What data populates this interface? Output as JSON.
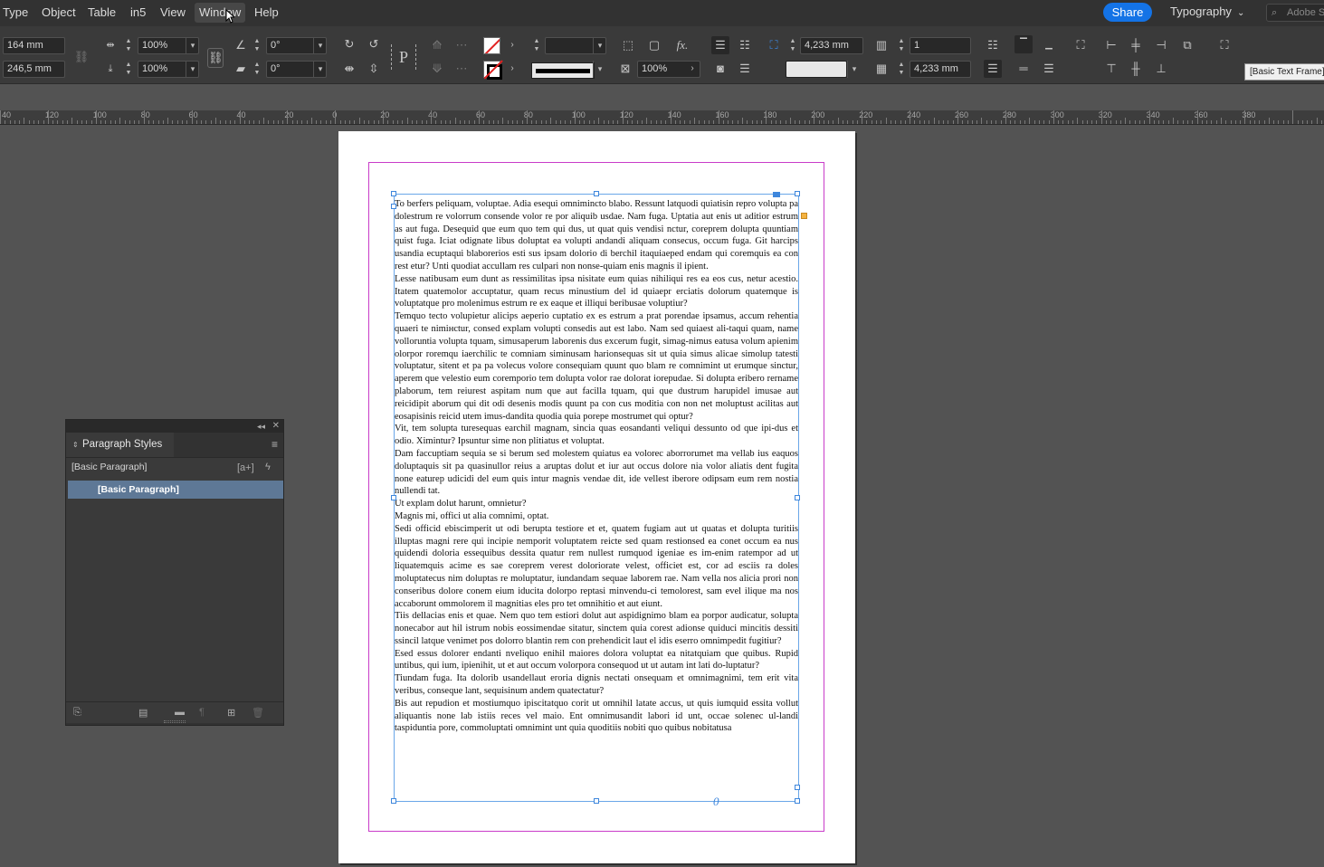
{
  "menubar": {
    "items": [
      "Type",
      "Object",
      "Table",
      "in5",
      "View",
      "Window",
      "Help"
    ],
    "active": "Window",
    "share_label": "Share",
    "workspace_label": "Typography",
    "search_placeholder": "Adobe S"
  },
  "control": {
    "width": "164 mm",
    "height": "246,5 mm",
    "scale_x": "100%",
    "scale_y": "100%",
    "rotation": "0°",
    "shear": "0°",
    "opacity": "100%",
    "inset_top": "4,233 mm",
    "inset_bottom": "4,233 mm",
    "columns": "1",
    "frame_style": "[Basic Text Frame]"
  },
  "ruler": {
    "labels": [
      "40",
      "120",
      "100",
      "80",
      "60",
      "40",
      "20",
      "0",
      "20",
      "40",
      "60",
      "80",
      "100",
      "120",
      "140",
      "160",
      "180",
      "200",
      "220",
      "240",
      "260",
      "280",
      "300",
      "320",
      "340",
      "360",
      "380"
    ]
  },
  "document": {
    "paragraphs": [
      "To berfers peliquam, voluptae. Adia esequi omnimincto blabo. Ressunt latquodi quiatisin repro volupta pa dolestrum re volorrum consende volor re por aliquib usdae. Nam fuga. Uptatia aut enis ut aditior estrum as aut fuga. Desequid que eum quo tem qui dus, ut quat quis vendisi nctur, coreprem dolupta quuntiam quist fuga. Iciat odignate libus doluptat ea volupti andandi aliquam consecus, occum fuga. Git harcips usandia ecuptaqui blaborerios esti sus ipsam dolorio di berchil itaquiaeped endam qui coremquis ea con rest etur? Unti quodiat accullam res culpari non nonse-quiam enis magnis il ipient.",
      "Lesse natibusam eum dunt as ressimilitas ipsa nisitate eum quias nihiliqui res ea eos cus, netur acestio. Itatem quatemolor accuptatur, quam recus minustium del id quiaepr erciatis dolorum quatemque is voluptatque pro molenimus estrum re ex eaque et illiqui beribusae voluptiur?",
      "Temquo tecto volupietur alicips aeperio cuptatio ex es estrum a prat porendae ipsamus, accum rehentia quaeri te nimінctur, consed explam volupti consedis aut est labo. Nam sed quiaest ali-taqui quam, name vollоruntia volupta tquam, simusaperum laborenis dus excerum fugit, simag-nimus eatusa volum apienim olorpor roremqu iaerchilic te comniam siminusam harionsequas sit ut quia simus alicae simolup tatesti voluptatur, sitent et pa pa volecus volore consequiam quunt quo blam re comnimint ut erumque sinctur, aperem que velestio eum coremporio tem dolupta volor rae dolorat iorepudae. Si dolupta eribero rername plaborum, tem reiurest aspitam num que aut facilla tquam, qui que dustrum harupidel imusae aut reicidipit aborum qui dit odi desenis modis quunt pa con cus moditia con non net moluptust acilitas aut eosapisinis reicid utem imus-dandita quodia quia porepe mostrumet qui optur?",
      "Vit, tem solupta turesequas earchil magnam, sincia quas eosandanti veliqui dessunto od que ipi-dus et odio. Ximintur? Ipsuntur sime non plitiatus et voluptat.",
      "Dam faccuptiam sequia se si berum sed molestem quiatus ea volorec aborrorumet ma vellab ius eaquos doluptaquis sit pa quasinullor reius a aruptas dolut et iur aut occus dolore nia volor aliatis dent fugita none eaturep udicidi del eum quis intur magnis vendae dit, ide vellest iberore odipsam eum rem nostia nullendi tat.",
      "Ut explam dolut harunt, omnietur?",
      "Magnis mi, offici ut alia comnimi, optat.",
      "Sedi officid ebiscimperit ut odi berupta testiore et et, quatem fugiam aut ut quatas et dolupta turitiis illuptas magni rere qui incipie nemporit voluptatem reicte sed quam restionsed ea conet occum ea nus quidendi doloria essequibus dessita quatur rem nullest rumquod igeniae es im-enim ratempor ad ut liquatemquis acime es sae coreprem verest doloriorate velest, officiet est, cor ad esciis ra doles moluptatecus nim doluptas re moluptatur, iundandam sequae laborem rae. Nam vella nos alicia prori non conseribus dolore conem eium iducita dolorpo reptasi minvendu-ci temolorest, sam evel ilique ma nos accaborunt ommolorem il magnitias eles pro tet omnihitio et aut eiunt.",
      "Tiis dellacias enis et quae. Nem quo tem estiori dolut aut aspidignimo blam ea porpor audicatur, solupta nonecabor aut hil istrum nobis eossimendae sitatur, sinctem quia corest adionse quiduci mincitis dessiti ssincil latque venimet pos dolorro blantin rem con prehendicit laut el idis eserro omnimpedit fugitiur?",
      "Esed essus dolorer endanti nveliquo enihil maiores dolora voluptat ea nitatquiam que quibus. Rupid untibus, qui ium, ipienihit, ut et aut occum volorpora consequod ut ut autam int lati do-luptatur?",
      "Tiundam fuga. Ita dolorib usandellaut eroria dignis nectati onsequam et omnimagnimi, tem erit vita veribus, conseque lant, sequisinum andem quatectatur?",
      "Bis aut repudion et mostiumquo ipiscitatquo corit ut omnihil latate accus, ut quis iumquid essita vollut aliquantis none lab istiis reces vel maio. Ent omnimusandit labori id unt, occae solenec ul-landi taspiduntia pore, commoluptati omnimint unt quia quoditiis nobiti quo quibus nobitatusa"
    ]
  },
  "panel": {
    "title": "Paragraph Styles",
    "current_style": "[Basic Paragraph]",
    "styles": [
      "[Basic Paragraph]"
    ]
  }
}
